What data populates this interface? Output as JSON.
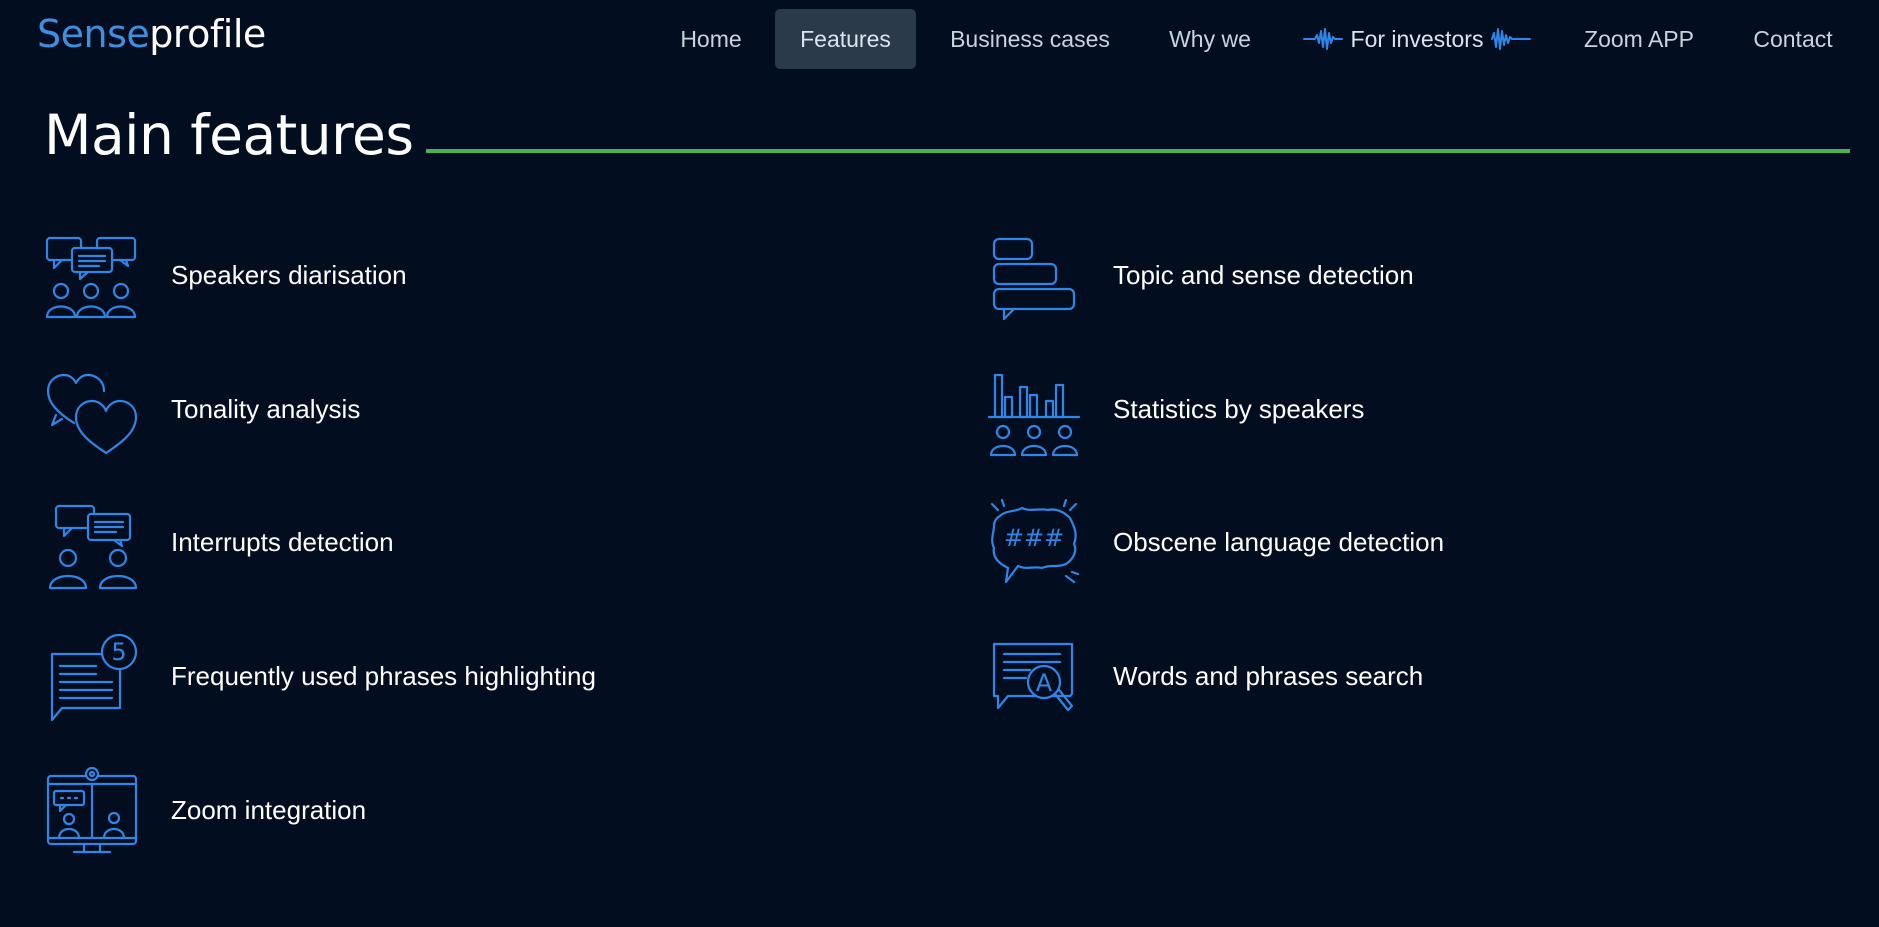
{
  "logo": {
    "part1": "Sense",
    "part2": "profile"
  },
  "nav": {
    "home": "Home",
    "features": "Features",
    "business_cases": "Business cases",
    "why_we": "Why we",
    "for_investors": "For investors",
    "zoom_app": "Zoom APP",
    "contact": "Contact"
  },
  "page": {
    "title": "Main features"
  },
  "features": {
    "speakers_diarisation": "Speakers diarisation",
    "topic_sense": "Topic and sense detection",
    "tonality": "Tonality analysis",
    "stats_speakers": "Statistics by speakers",
    "interrupts": "Interrupts detection",
    "obscene": "Obscene language detection",
    "frequent_phrases": "Frequently used phrases highlighting",
    "words_search": "Words and phrases search",
    "zoom_integration": "Zoom integration"
  },
  "icons": {
    "frequent_badge": "5",
    "obscene_symbols": "###",
    "search_letter": "A"
  },
  "colors": {
    "background": "#020e1f",
    "accent_blue": "#2f86e6",
    "rule_green": "#4caf50",
    "nav_active_bg": "#2b3a4b"
  }
}
